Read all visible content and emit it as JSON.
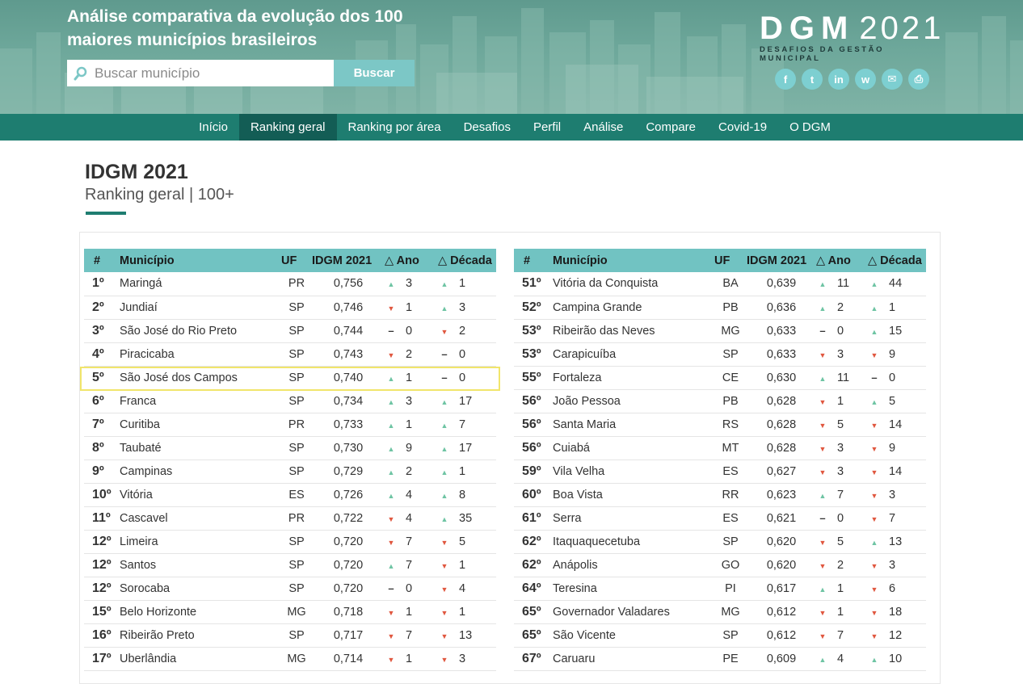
{
  "header": {
    "title": "Análise comparativa da evolução dos 100 maiores municípios brasileiros",
    "search_placeholder": "Buscar município",
    "search_button": "Buscar",
    "logo_main_left": "DGM",
    "logo_main_right": "2021",
    "logo_sub": "DESAFIOS DA GESTÃO MUNICIPAL",
    "social": [
      {
        "icon": "facebook-icon",
        "glyph": "f"
      },
      {
        "icon": "twitter-icon",
        "glyph": "t"
      },
      {
        "icon": "linkedin-icon",
        "glyph": "in"
      },
      {
        "icon": "whatsapp-icon",
        "glyph": "w"
      },
      {
        "icon": "email-icon",
        "glyph": "✉"
      },
      {
        "icon": "print-icon",
        "glyph": "⎙"
      }
    ]
  },
  "nav": {
    "items": [
      "Início",
      "Ranking geral",
      "Ranking por área",
      "Desafios",
      "Perfil",
      "Análise",
      "Compare",
      "Covid-19",
      "O DGM"
    ],
    "active": "Ranking geral"
  },
  "page": {
    "title": "IDGM 2021",
    "subtitle": "Ranking geral | 100+"
  },
  "table": {
    "columns": [
      "#",
      "Município",
      "UF",
      "IDGM 2021",
      "△ Ano",
      "△ Década"
    ],
    "left_rows": [
      {
        "pos": "1º",
        "city": "Maringá",
        "uf": "PR",
        "idgm": "0,756",
        "ano_dir": "up",
        "ano": "3",
        "dec_dir": "up",
        "dec": "1"
      },
      {
        "pos": "2º",
        "city": "Jundiaí",
        "uf": "SP",
        "idgm": "0,746",
        "ano_dir": "down",
        "ano": "1",
        "dec_dir": "up",
        "dec": "3"
      },
      {
        "pos": "3º",
        "city": "São José do Rio Preto",
        "uf": "SP",
        "idgm": "0,744",
        "ano_dir": "eq",
        "ano": "0",
        "dec_dir": "down",
        "dec": "2"
      },
      {
        "pos": "4º",
        "city": "Piracicaba",
        "uf": "SP",
        "idgm": "0,743",
        "ano_dir": "down",
        "ano": "2",
        "dec_dir": "eq",
        "dec": "0"
      },
      {
        "pos": "5º",
        "city": "São José dos Campos",
        "uf": "SP",
        "idgm": "0,740",
        "ano_dir": "up",
        "ano": "1",
        "dec_dir": "eq",
        "dec": "0"
      },
      {
        "pos": "6º",
        "city": "Franca",
        "uf": "SP",
        "idgm": "0,734",
        "ano_dir": "up",
        "ano": "3",
        "dec_dir": "up",
        "dec": "17"
      },
      {
        "pos": "7º",
        "city": "Curitiba",
        "uf": "PR",
        "idgm": "0,733",
        "ano_dir": "up",
        "ano": "1",
        "dec_dir": "up",
        "dec": "7"
      },
      {
        "pos": "8º",
        "city": "Taubaté",
        "uf": "SP",
        "idgm": "0,730",
        "ano_dir": "up",
        "ano": "9",
        "dec_dir": "up",
        "dec": "17"
      },
      {
        "pos": "9º",
        "city": "Campinas",
        "uf": "SP",
        "idgm": "0,729",
        "ano_dir": "up",
        "ano": "2",
        "dec_dir": "up",
        "dec": "1"
      },
      {
        "pos": "10º",
        "city": "Vitória",
        "uf": "ES",
        "idgm": "0,726",
        "ano_dir": "up",
        "ano": "4",
        "dec_dir": "up",
        "dec": "8"
      },
      {
        "pos": "11º",
        "city": "Cascavel",
        "uf": "PR",
        "idgm": "0,722",
        "ano_dir": "down",
        "ano": "4",
        "dec_dir": "up",
        "dec": "35"
      },
      {
        "pos": "12º",
        "city": "Limeira",
        "uf": "SP",
        "idgm": "0,720",
        "ano_dir": "down",
        "ano": "7",
        "dec_dir": "down",
        "dec": "5"
      },
      {
        "pos": "12º",
        "city": "Santos",
        "uf": "SP",
        "idgm": "0,720",
        "ano_dir": "up",
        "ano": "7",
        "dec_dir": "down",
        "dec": "1"
      },
      {
        "pos": "12º",
        "city": "Sorocaba",
        "uf": "SP",
        "idgm": "0,720",
        "ano_dir": "eq",
        "ano": "0",
        "dec_dir": "down",
        "dec": "4"
      },
      {
        "pos": "15º",
        "city": "Belo Horizonte",
        "uf": "MG",
        "idgm": "0,718",
        "ano_dir": "down",
        "ano": "1",
        "dec_dir": "down",
        "dec": "1"
      },
      {
        "pos": "16º",
        "city": "Ribeirão Preto",
        "uf": "SP",
        "idgm": "0,717",
        "ano_dir": "down",
        "ano": "7",
        "dec_dir": "down",
        "dec": "13"
      },
      {
        "pos": "17º",
        "city": "Uberlândia",
        "uf": "MG",
        "idgm": "0,714",
        "ano_dir": "down",
        "ano": "1",
        "dec_dir": "down",
        "dec": "3"
      }
    ],
    "right_rows": [
      {
        "pos": "51º",
        "city": "Vitória da Conquista",
        "uf": "BA",
        "idgm": "0,639",
        "ano_dir": "up",
        "ano": "11",
        "dec_dir": "up",
        "dec": "44"
      },
      {
        "pos": "52º",
        "city": "Campina Grande",
        "uf": "PB",
        "idgm": "0,636",
        "ano_dir": "up",
        "ano": "2",
        "dec_dir": "up",
        "dec": "1"
      },
      {
        "pos": "53º",
        "city": "Ribeirão das Neves",
        "uf": "MG",
        "idgm": "0,633",
        "ano_dir": "eq",
        "ano": "0",
        "dec_dir": "up",
        "dec": "15"
      },
      {
        "pos": "53º",
        "city": "Carapicuíba",
        "uf": "SP",
        "idgm": "0,633",
        "ano_dir": "down",
        "ano": "3",
        "dec_dir": "down",
        "dec": "9"
      },
      {
        "pos": "55º",
        "city": "Fortaleza",
        "uf": "CE",
        "idgm": "0,630",
        "ano_dir": "up",
        "ano": "11",
        "dec_dir": "eq",
        "dec": "0"
      },
      {
        "pos": "56º",
        "city": "João Pessoa",
        "uf": "PB",
        "idgm": "0,628",
        "ano_dir": "down",
        "ano": "1",
        "dec_dir": "up",
        "dec": "5"
      },
      {
        "pos": "56º",
        "city": "Santa Maria",
        "uf": "RS",
        "idgm": "0,628",
        "ano_dir": "down",
        "ano": "5",
        "dec_dir": "down",
        "dec": "14"
      },
      {
        "pos": "56º",
        "city": "Cuiabá",
        "uf": "MT",
        "idgm": "0,628",
        "ano_dir": "down",
        "ano": "3",
        "dec_dir": "down",
        "dec": "9"
      },
      {
        "pos": "59º",
        "city": "Vila Velha",
        "uf": "ES",
        "idgm": "0,627",
        "ano_dir": "down",
        "ano": "3",
        "dec_dir": "down",
        "dec": "14"
      },
      {
        "pos": "60º",
        "city": "Boa Vista",
        "uf": "RR",
        "idgm": "0,623",
        "ano_dir": "up",
        "ano": "7",
        "dec_dir": "down",
        "dec": "3"
      },
      {
        "pos": "61º",
        "city": "Serra",
        "uf": "ES",
        "idgm": "0,621",
        "ano_dir": "eq",
        "ano": "0",
        "dec_dir": "down",
        "dec": "7"
      },
      {
        "pos": "62º",
        "city": "Itaquaquecetuba",
        "uf": "SP",
        "idgm": "0,620",
        "ano_dir": "down",
        "ano": "5",
        "dec_dir": "up",
        "dec": "13"
      },
      {
        "pos": "62º",
        "city": "Anápolis",
        "uf": "GO",
        "idgm": "0,620",
        "ano_dir": "down",
        "ano": "2",
        "dec_dir": "down",
        "dec": "3"
      },
      {
        "pos": "64º",
        "city": "Teresina",
        "uf": "PI",
        "idgm": "0,617",
        "ano_dir": "up",
        "ano": "1",
        "dec_dir": "down",
        "dec": "6"
      },
      {
        "pos": "65º",
        "city": "Governador Valadares",
        "uf": "MG",
        "idgm": "0,612",
        "ano_dir": "down",
        "ano": "1",
        "dec_dir": "down",
        "dec": "18"
      },
      {
        "pos": "65º",
        "city": "São Vicente",
        "uf": "SP",
        "idgm": "0,612",
        "ano_dir": "down",
        "ano": "7",
        "dec_dir": "down",
        "dec": "12"
      },
      {
        "pos": "67º",
        "city": "Caruaru",
        "uf": "PE",
        "idgm": "0,609",
        "ano_dir": "up",
        "ano": "4",
        "dec_dir": "up",
        "dec": "10"
      }
    ],
    "highlighted_city": "São José dos Campos"
  },
  "colors": {
    "nav_bg": "#1e7d70",
    "nav_active": "#135d55",
    "table_header": "#71c3c2",
    "rank_number": "#6fc0bd",
    "arrow_up": "#6ec4a3",
    "arrow_down": "#e0573f",
    "highlight_border": "#f1e56b"
  }
}
